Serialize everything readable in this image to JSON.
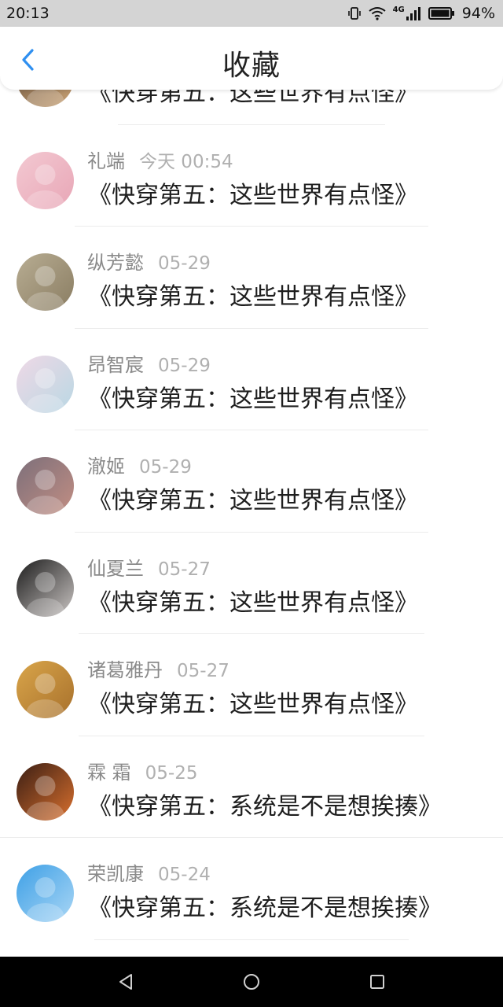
{
  "status_bar": {
    "time": "20:13",
    "network": "4G",
    "battery": "94%"
  },
  "header": {
    "title": "收藏",
    "back_icon": "chevron-left-icon",
    "accent": "#2f8ff0"
  },
  "favorites": [
    {
      "name": "",
      "time": "",
      "title": "《快穿第五：这些世界有点怪》",
      "avatar_colors": [
        "#6b5540",
        "#c9a173"
      ]
    },
    {
      "name": "礼端",
      "time": "今天 00:54",
      "title": "《快穿第五：这些世界有点怪》",
      "avatar_colors": [
        "#f3c9d2",
        "#e8a6b6"
      ]
    },
    {
      "name": "纵芳懿",
      "time": "05-29",
      "title": "《快穿第五：这些世界有点怪》",
      "avatar_colors": [
        "#b8ad93",
        "#8a7d62"
      ]
    },
    {
      "name": "昂智宸",
      "time": "05-29",
      "title": "《快穿第五：这些世界有点怪》",
      "avatar_colors": [
        "#efd9e6",
        "#b9d7e3"
      ]
    },
    {
      "name": "澈姬",
      "time": "05-29",
      "title": "《快穿第五：这些世界有点怪》",
      "avatar_colors": [
        "#7c6f7a",
        "#c28e83"
      ]
    },
    {
      "name": "仙夏兰",
      "time": "05-27",
      "title": "《快穿第五：这些世界有点怪》",
      "avatar_colors": [
        "#1c1c1c",
        "#c9c4c2"
      ]
    },
    {
      "name": "诸葛雅丹",
      "time": "05-27",
      "title": "《快穿第五：这些世界有点怪》",
      "avatar_colors": [
        "#d9a54a",
        "#a8712c"
      ]
    },
    {
      "name": "霖 霜",
      "time": "05-25",
      "title": "《快穿第五：系统是不是想挨揍》",
      "avatar_colors": [
        "#3a1e14",
        "#d9702e"
      ]
    },
    {
      "name": "荣凯康",
      "time": "05-24",
      "title": "《快穿第五：系统是不是想挨揍》",
      "avatar_colors": [
        "#3ea0e6",
        "#a9d6f5"
      ]
    }
  ],
  "nav_bar": {
    "back": "triangle-back-icon",
    "home": "circle-home-icon",
    "recents": "square-recents-icon"
  }
}
